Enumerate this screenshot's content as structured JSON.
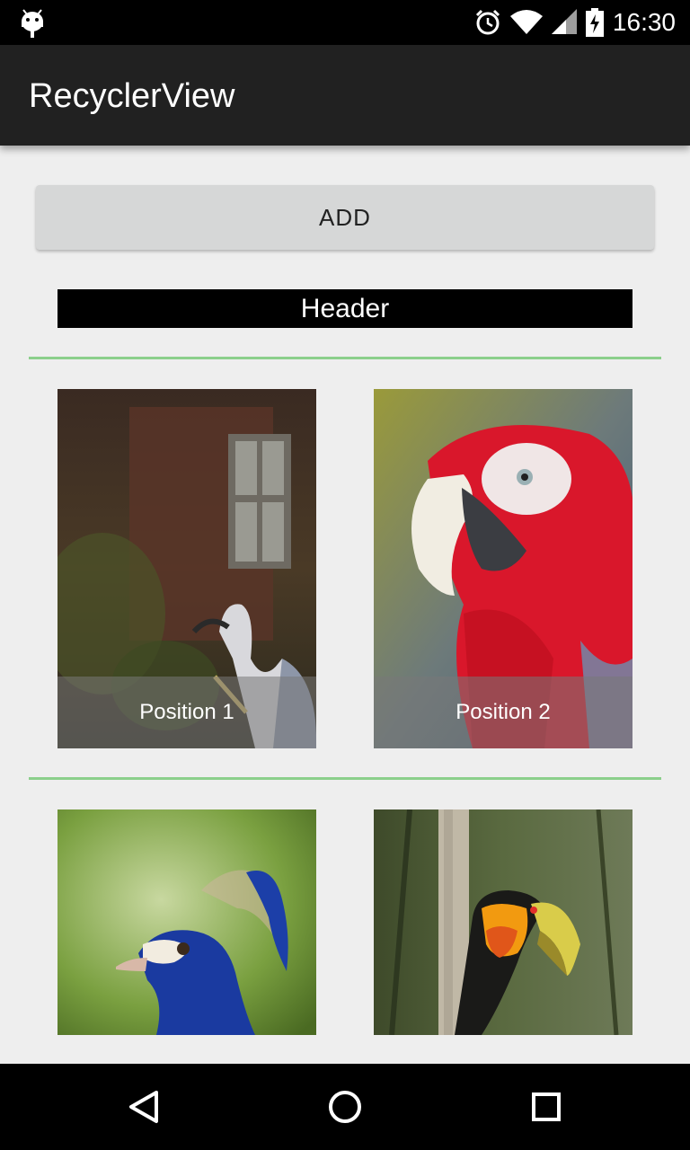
{
  "status_bar": {
    "time": "16:30",
    "icons": [
      "android-debug-icon",
      "alarm-icon",
      "wifi-icon",
      "signal-icon",
      "battery-charging-icon"
    ]
  },
  "app_bar": {
    "title": "RecyclerView"
  },
  "add_button": {
    "label": "ADD"
  },
  "list": {
    "header": "Header",
    "items": [
      {
        "caption": "Position 1",
        "image": "heron"
      },
      {
        "caption": "Position 2",
        "image": "macaw"
      },
      {
        "caption": "",
        "image": "peacock"
      },
      {
        "caption": "",
        "image": "toucan"
      }
    ]
  },
  "colors": {
    "status_bar": "#000000",
    "app_bar": "#212121",
    "background": "#eeeeee",
    "button": "#d6d7d7",
    "divider": "#8bcf8b"
  },
  "nav_bar": {
    "icons": [
      "back-icon",
      "home-icon",
      "recents-icon"
    ]
  }
}
